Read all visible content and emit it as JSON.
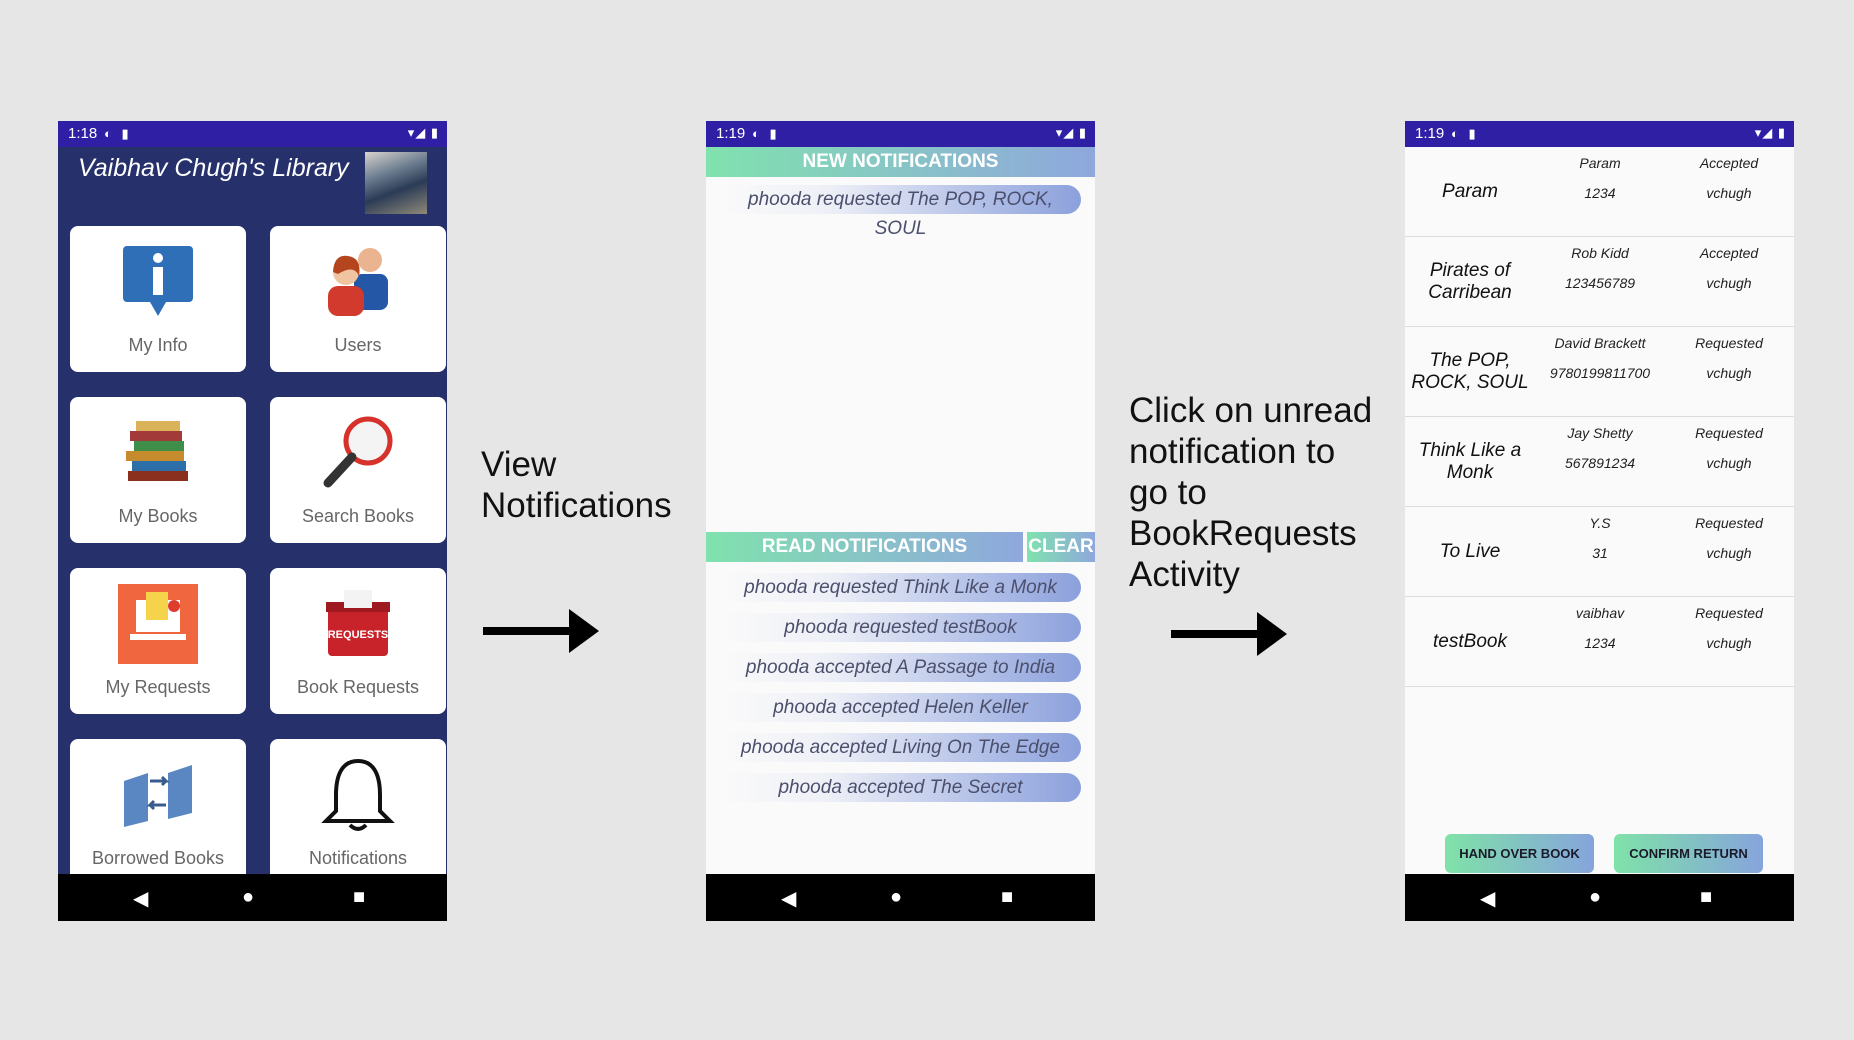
{
  "phone1": {
    "status": {
      "time": "1:18"
    },
    "title": "Vaibhav Chugh's Library",
    "tiles": [
      {
        "label": "My Info",
        "icon": "info-icon"
      },
      {
        "label": "Users",
        "icon": "users-icon"
      },
      {
        "label": "My Books",
        "icon": "books-stack-icon"
      },
      {
        "label": "Search Books",
        "icon": "magnifier-icon"
      },
      {
        "label": "My Requests",
        "icon": "requests-icon"
      },
      {
        "label": "Book Requests",
        "icon": "request-box-icon"
      },
      {
        "label": "Borrowed Books",
        "icon": "swap-books-icon"
      },
      {
        "label": "Notifications",
        "icon": "bell-icon"
      }
    ]
  },
  "caption1": "View\nNotifications",
  "phone2": {
    "status": {
      "time": "1:19"
    },
    "new_header": "NEW NOTIFICATIONS",
    "new_items": [
      "phooda requested The POP, ROCK, SOUL"
    ],
    "read_header": "READ NOTIFICATIONS",
    "clear_label": "CLEAR",
    "read_items": [
      "phooda requested Think Like a Monk",
      "phooda requested testBook",
      "phooda accepted A Passage to India",
      "phooda accepted Helen Keller",
      "phooda accepted Living On The Edge",
      "phooda accepted The Secret"
    ]
  },
  "caption2": "Click on unread\nnotification to\ngo to\nBookRequests\nActivity",
  "phone3": {
    "status": {
      "time": "1:19"
    },
    "rows": [
      {
        "book": "Param",
        "author": "Param",
        "isbn": "1234",
        "status": "Accepted",
        "user": "vchugh"
      },
      {
        "book": "Pirates of Carribean",
        "author": "Rob Kidd",
        "isbn": "123456789",
        "status": "Accepted",
        "user": "vchugh"
      },
      {
        "book": "The POP, ROCK, SOUL",
        "author": "David Brackett",
        "isbn": "9780199811700",
        "status": "Requested",
        "user": "vchugh"
      },
      {
        "book": "Think Like a Monk",
        "author": "Jay Shetty",
        "isbn": "567891234",
        "status": "Requested",
        "user": "vchugh"
      },
      {
        "book": "To Live",
        "author": "Y.S",
        "isbn": "31",
        "status": "Requested",
        "user": "vchugh"
      },
      {
        "book": "testBook",
        "author": "vaibhav",
        "isbn": "1234",
        "status": "Requested",
        "user": "vchugh"
      }
    ],
    "hand_over_label": "HAND OVER BOOK",
    "confirm_return_label": "CONFIRM RETURN"
  },
  "colors": {
    "status_bar": "#2f1fa5",
    "library_bg": "#26306b",
    "gradient_start": "#80e2ae",
    "gradient_end": "#8fa7dd"
  }
}
